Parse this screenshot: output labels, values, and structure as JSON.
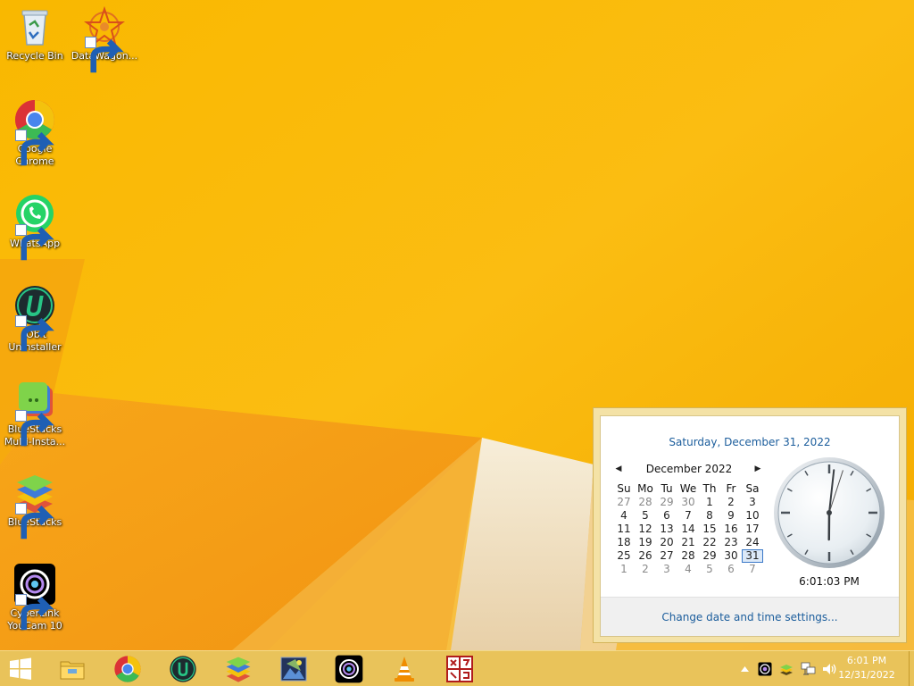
{
  "desktop": {
    "icons": [
      {
        "label": "Recycle Bin"
      },
      {
        "label": "DataWagon..."
      },
      {
        "label": "Google Chrome"
      },
      {
        "label": "WhatsApp"
      },
      {
        "label": "IObit Uninstaller"
      },
      {
        "label": "BlueStacks Multi-Insta..."
      },
      {
        "label": "BlueStacks"
      },
      {
        "label": "CyberLink YouCam 10"
      }
    ]
  },
  "taskbar": {
    "pinned": [
      "start-windows-icon",
      "file-explorer-icon",
      "chrome-icon",
      "iobit-icon",
      "bluestacks-icon",
      "media-app-icon",
      "youcam-icon",
      "vlc-icon",
      "app-red-icon"
    ],
    "tray_icons": [
      "tray-up-chevron-icon",
      "tray-youcam-icon",
      "tray-bluestacks-icon",
      "tray-network-icon",
      "tray-volume-icon"
    ],
    "clock": {
      "time": "6:01 PM",
      "date": "12/31/2022"
    }
  },
  "calendar": {
    "heading": "Saturday, December 31, 2022",
    "month_label": "December 2022",
    "prev_arrow": "◀",
    "next_arrow": "▶",
    "weekdays": [
      "Su",
      "Mo",
      "Tu",
      "We",
      "Th",
      "Fr",
      "Sa"
    ],
    "weeks": [
      [
        {
          "d": "27",
          "dim": true
        },
        {
          "d": "28",
          "dim": true
        },
        {
          "d": "29",
          "dim": true
        },
        {
          "d": "30",
          "dim": true
        },
        {
          "d": "1"
        },
        {
          "d": "2"
        },
        {
          "d": "3"
        }
      ],
      [
        {
          "d": "4"
        },
        {
          "d": "5"
        },
        {
          "d": "6"
        },
        {
          "d": "7"
        },
        {
          "d": "8"
        },
        {
          "d": "9"
        },
        {
          "d": "10"
        }
      ],
      [
        {
          "d": "11"
        },
        {
          "d": "12"
        },
        {
          "d": "13"
        },
        {
          "d": "14"
        },
        {
          "d": "15"
        },
        {
          "d": "16"
        },
        {
          "d": "17"
        }
      ],
      [
        {
          "d": "18"
        },
        {
          "d": "19"
        },
        {
          "d": "20"
        },
        {
          "d": "21"
        },
        {
          "d": "22"
        },
        {
          "d": "23"
        },
        {
          "d": "24"
        }
      ],
      [
        {
          "d": "25"
        },
        {
          "d": "26"
        },
        {
          "d": "27"
        },
        {
          "d": "28"
        },
        {
          "d": "29"
        },
        {
          "d": "30"
        },
        {
          "d": "31",
          "today": true
        }
      ],
      [
        {
          "d": "1",
          "dim": true
        },
        {
          "d": "2",
          "dim": true
        },
        {
          "d": "3",
          "dim": true
        },
        {
          "d": "4",
          "dim": true
        },
        {
          "d": "5",
          "dim": true
        },
        {
          "d": "6",
          "dim": true
        },
        {
          "d": "7",
          "dim": true
        }
      ]
    ],
    "digital_time": "6:01:03 PM",
    "footer_link": "Change date and time settings..."
  },
  "colors": {
    "wallpaper": "#f7b600",
    "taskbar": "#e9c35a",
    "link": "#1b5d9c",
    "today_border": "#3a78c8"
  }
}
